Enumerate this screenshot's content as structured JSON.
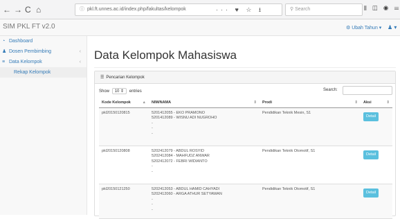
{
  "browser": {
    "back": "←",
    "forward": "→",
    "reload": "C",
    "home": "⌂",
    "url": "pkl.ft.unnes.ac.id/index.php/fakultas/kelompok",
    "url_actions": "··· ♥ ☆ ⭳",
    "search_placeholder": "Search",
    "toolbar_icons": "⫴ ◫ ◉ ☰"
  },
  "app": {
    "brand": "SIM PKL FT v2.0",
    "year_menu": "⚙ Ubah Tahun ▾",
    "user_menu": "♟ ▾"
  },
  "sidebar": {
    "items": [
      {
        "icon": "◔",
        "label": "Dashboard",
        "chevron": ""
      },
      {
        "icon": "♟",
        "label": "Dosen Pembimbing",
        "chevron": "‹"
      },
      {
        "icon": "≡",
        "label": "Data Kelompok",
        "chevron": "‹"
      },
      {
        "icon": "",
        "label": "Rekap Kelompok",
        "chevron": ""
      }
    ]
  },
  "main": {
    "title": "Data Kelompok Mahasiswa",
    "panel_title": "Pencarian Kelompok",
    "show_label": "Show",
    "entries_value": "10",
    "entries_label": "entries",
    "search_label": "Search:",
    "columns": [
      {
        "label": "Kode Kelompok",
        "sort": "▲"
      },
      {
        "label": "NIM/NAMA",
        "sort": "⇕"
      },
      {
        "label": "Prodi",
        "sort": "⇕"
      },
      {
        "label": "Aksi",
        "sort": "⇕"
      }
    ],
    "rows": [
      {
        "kode": "pkl20150120815",
        "members": [
          "5201412055 - EKO PRAMONO",
          "5201412089 - WISNU ADI NUGROHO",
          "-",
          "-",
          "-"
        ],
        "prodi": "Pendidikan Teknik Mesin, S1",
        "action": "Detail"
      },
      {
        "kode": "pkl20150120808",
        "members": [
          "5202412079 - ABDUL ROSYID",
          "5202412084 - MAHFUDZ ANWAR",
          "5202412072 - FEBRI WIDIANTO",
          "-",
          "-"
        ],
        "prodi": "Pendidikan Teknik Otomotif, S1",
        "action": "Detail"
      },
      {
        "kode": "pkl20150121250",
        "members": [
          "5202412053 - ABDUL HAMID CAHYADI",
          "5202412060 - ARGA ATHUR SETYAWAN",
          "-",
          "-",
          "-"
        ],
        "prodi": "Pendidikan Teknik Otomotif, S1",
        "action": "Detail"
      }
    ]
  }
}
